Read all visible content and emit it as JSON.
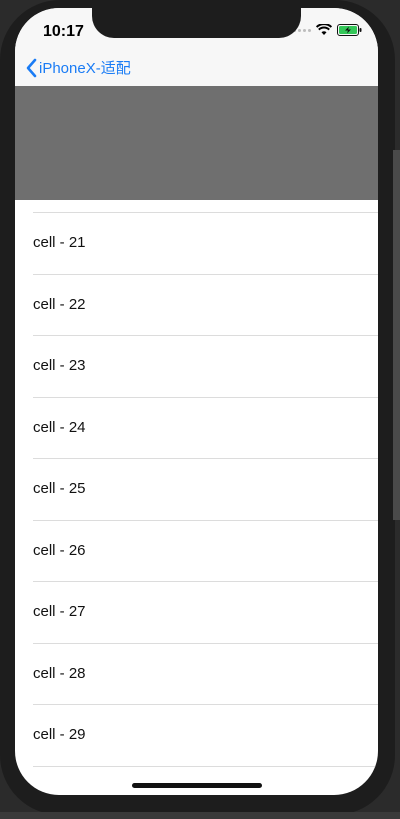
{
  "status_bar": {
    "time": "10:17",
    "icons": [
      "signal-dots-icon",
      "wifi-icon",
      "battery-charging-icon"
    ],
    "battery_color": "#34c759"
  },
  "nav": {
    "back_label": "iPhoneX-适配",
    "accent_color": "#1a7cf5"
  },
  "header": {
    "color": "#6f6f6f"
  },
  "cells": [
    "cell - 21",
    "cell - 22",
    "cell - 23",
    "cell - 24",
    "cell - 25",
    "cell - 26",
    "cell - 27",
    "cell - 28",
    "cell - 29"
  ]
}
